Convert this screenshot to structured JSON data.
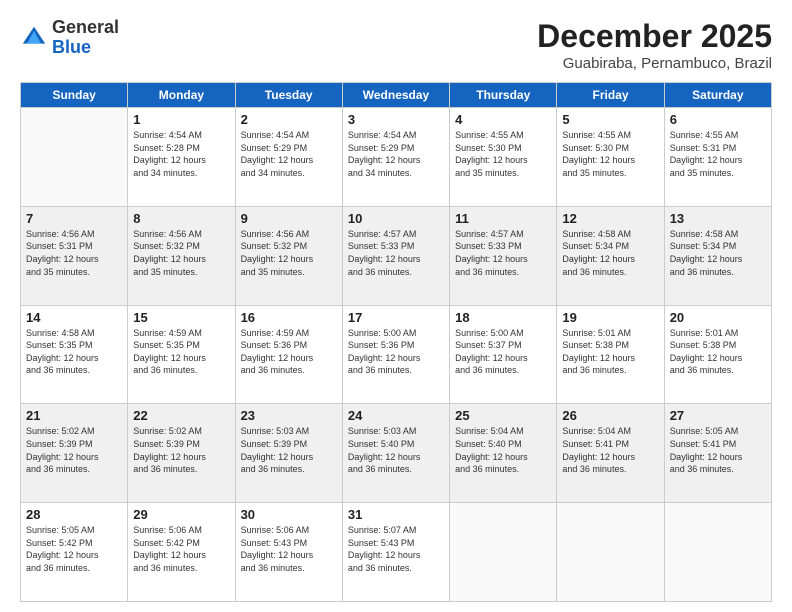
{
  "logo": {
    "general": "General",
    "blue": "Blue"
  },
  "title": "December 2025",
  "location": "Guabiraba, Pernambuco, Brazil",
  "weekdays": [
    "Sunday",
    "Monday",
    "Tuesday",
    "Wednesday",
    "Thursday",
    "Friday",
    "Saturday"
  ],
  "weeks": [
    [
      {
        "day": "",
        "info": ""
      },
      {
        "day": "1",
        "info": "Sunrise: 4:54 AM\nSunset: 5:28 PM\nDaylight: 12 hours\nand 34 minutes."
      },
      {
        "day": "2",
        "info": "Sunrise: 4:54 AM\nSunset: 5:29 PM\nDaylight: 12 hours\nand 34 minutes."
      },
      {
        "day": "3",
        "info": "Sunrise: 4:54 AM\nSunset: 5:29 PM\nDaylight: 12 hours\nand 34 minutes."
      },
      {
        "day": "4",
        "info": "Sunrise: 4:55 AM\nSunset: 5:30 PM\nDaylight: 12 hours\nand 35 minutes."
      },
      {
        "day": "5",
        "info": "Sunrise: 4:55 AM\nSunset: 5:30 PM\nDaylight: 12 hours\nand 35 minutes."
      },
      {
        "day": "6",
        "info": "Sunrise: 4:55 AM\nSunset: 5:31 PM\nDaylight: 12 hours\nand 35 minutes."
      }
    ],
    [
      {
        "day": "7",
        "info": "Sunrise: 4:56 AM\nSunset: 5:31 PM\nDaylight: 12 hours\nand 35 minutes."
      },
      {
        "day": "8",
        "info": "Sunrise: 4:56 AM\nSunset: 5:32 PM\nDaylight: 12 hours\nand 35 minutes."
      },
      {
        "day": "9",
        "info": "Sunrise: 4:56 AM\nSunset: 5:32 PM\nDaylight: 12 hours\nand 35 minutes."
      },
      {
        "day": "10",
        "info": "Sunrise: 4:57 AM\nSunset: 5:33 PM\nDaylight: 12 hours\nand 36 minutes."
      },
      {
        "day": "11",
        "info": "Sunrise: 4:57 AM\nSunset: 5:33 PM\nDaylight: 12 hours\nand 36 minutes."
      },
      {
        "day": "12",
        "info": "Sunrise: 4:58 AM\nSunset: 5:34 PM\nDaylight: 12 hours\nand 36 minutes."
      },
      {
        "day": "13",
        "info": "Sunrise: 4:58 AM\nSunset: 5:34 PM\nDaylight: 12 hours\nand 36 minutes."
      }
    ],
    [
      {
        "day": "14",
        "info": "Sunrise: 4:58 AM\nSunset: 5:35 PM\nDaylight: 12 hours\nand 36 minutes."
      },
      {
        "day": "15",
        "info": "Sunrise: 4:59 AM\nSunset: 5:35 PM\nDaylight: 12 hours\nand 36 minutes."
      },
      {
        "day": "16",
        "info": "Sunrise: 4:59 AM\nSunset: 5:36 PM\nDaylight: 12 hours\nand 36 minutes."
      },
      {
        "day": "17",
        "info": "Sunrise: 5:00 AM\nSunset: 5:36 PM\nDaylight: 12 hours\nand 36 minutes."
      },
      {
        "day": "18",
        "info": "Sunrise: 5:00 AM\nSunset: 5:37 PM\nDaylight: 12 hours\nand 36 minutes."
      },
      {
        "day": "19",
        "info": "Sunrise: 5:01 AM\nSunset: 5:38 PM\nDaylight: 12 hours\nand 36 minutes."
      },
      {
        "day": "20",
        "info": "Sunrise: 5:01 AM\nSunset: 5:38 PM\nDaylight: 12 hours\nand 36 minutes."
      }
    ],
    [
      {
        "day": "21",
        "info": "Sunrise: 5:02 AM\nSunset: 5:39 PM\nDaylight: 12 hours\nand 36 minutes."
      },
      {
        "day": "22",
        "info": "Sunrise: 5:02 AM\nSunset: 5:39 PM\nDaylight: 12 hours\nand 36 minutes."
      },
      {
        "day": "23",
        "info": "Sunrise: 5:03 AM\nSunset: 5:39 PM\nDaylight: 12 hours\nand 36 minutes."
      },
      {
        "day": "24",
        "info": "Sunrise: 5:03 AM\nSunset: 5:40 PM\nDaylight: 12 hours\nand 36 minutes."
      },
      {
        "day": "25",
        "info": "Sunrise: 5:04 AM\nSunset: 5:40 PM\nDaylight: 12 hours\nand 36 minutes."
      },
      {
        "day": "26",
        "info": "Sunrise: 5:04 AM\nSunset: 5:41 PM\nDaylight: 12 hours\nand 36 minutes."
      },
      {
        "day": "27",
        "info": "Sunrise: 5:05 AM\nSunset: 5:41 PM\nDaylight: 12 hours\nand 36 minutes."
      }
    ],
    [
      {
        "day": "28",
        "info": "Sunrise: 5:05 AM\nSunset: 5:42 PM\nDaylight: 12 hours\nand 36 minutes."
      },
      {
        "day": "29",
        "info": "Sunrise: 5:06 AM\nSunset: 5:42 PM\nDaylight: 12 hours\nand 36 minutes."
      },
      {
        "day": "30",
        "info": "Sunrise: 5:06 AM\nSunset: 5:43 PM\nDaylight: 12 hours\nand 36 minutes."
      },
      {
        "day": "31",
        "info": "Sunrise: 5:07 AM\nSunset: 5:43 PM\nDaylight: 12 hours\nand 36 minutes."
      },
      {
        "day": "",
        "info": ""
      },
      {
        "day": "",
        "info": ""
      },
      {
        "day": "",
        "info": ""
      }
    ]
  ]
}
